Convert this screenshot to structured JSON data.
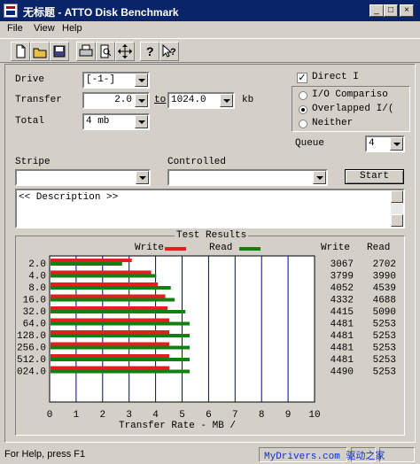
{
  "window": {
    "title": "无标题 - ATTO Disk Benchmark"
  },
  "menu": [
    "File",
    "View",
    "Help"
  ],
  "toolbar_icons": [
    "new-icon",
    "open-icon",
    "save-icon",
    "print-icon",
    "print-preview-icon",
    "move-icon",
    "help-icon",
    "context-help-icon"
  ],
  "form": {
    "drive_label": "Drive",
    "drive_value": "[-1-]",
    "transfer_label": "Transfer",
    "transfer_from": "2.0",
    "to_label": "to",
    "transfer_to": "1024.0",
    "kb_label": "kb",
    "total_label": "Total",
    "total_value": "4 mb",
    "direct_io_label": "Direct I",
    "direct_io_checked": true,
    "radio_io_comparison": "I/O Compariso",
    "radio_overlapped": "Overlapped I/(",
    "radio_neither": "Neither",
    "queue_label": "Queue",
    "queue_value": "4",
    "stripe_label": "Stripe",
    "controlled_label": "Controlled",
    "start_label": "Start",
    "description_text": "<< Description >>"
  },
  "results": {
    "group_title": "Test Results",
    "write_legend": "Write",
    "read_legend": "Read",
    "write_header": "Write",
    "read_header": "Read"
  },
  "chart_data": {
    "type": "bar",
    "orientation": "horizontal",
    "categories": [
      "2.0",
      "4.0",
      "8.0",
      "16.0",
      "32.0",
      "64.0",
      "128.0",
      "256.0",
      "512.0",
      "024.0"
    ],
    "series": [
      {
        "name": "Write",
        "color": "#e02020",
        "values": [
          3067,
          3799,
          4052,
          4332,
          4415,
          4481,
          4481,
          4481,
          4481,
          4490
        ]
      },
      {
        "name": "Read",
        "color": "#108010",
        "values": [
          2702,
          3990,
          4539,
          4688,
          5090,
          5253,
          5253,
          5253,
          5253,
          5253
        ]
      }
    ],
    "xlabel": "Transfer Rate - MB /",
    "xticks": [
      "0",
      "1",
      "2",
      "3",
      "4",
      "5",
      "6",
      "7",
      "8",
      "9",
      "10"
    ],
    "xlim": [
      0,
      10
    ],
    "value_unit": "per 1000 = 1 axis unit"
  },
  "status": {
    "help_text": "For Help, press F1",
    "watermark": "MyDrivers.com 驱动之家"
  }
}
